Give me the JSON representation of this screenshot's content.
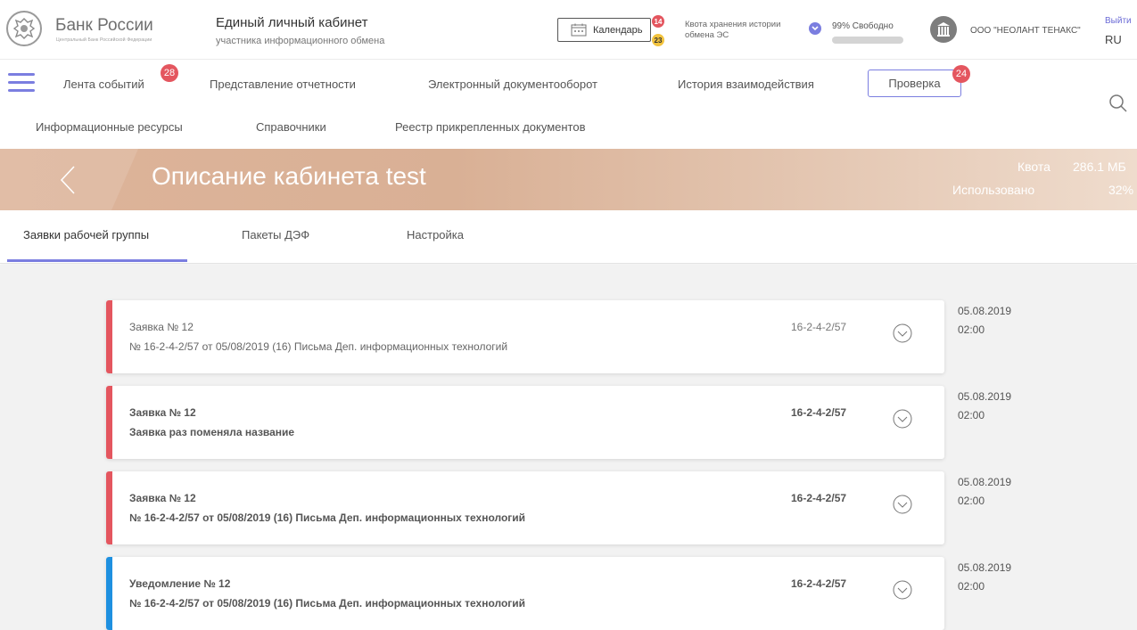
{
  "header": {
    "logo_title": "Банк России",
    "logo_sub": "Центральный Банк Российской Федерации",
    "app_title": "Единый личный кабинет",
    "app_subtitle": "участника информационного обмена",
    "calendar_label": "Календарь",
    "calendar_badge_red": "14",
    "calendar_badge_yellow": "23",
    "quota_label": "Квота хранения истории обмена ЭС",
    "quota_free": "99% Свободно",
    "quota_free_fraction": 0.99,
    "org_name": "ООО \"НЕОЛАНТ ТЕНАКС\"",
    "logout_label": "Выйти",
    "language": "RU"
  },
  "nav": {
    "events": "Лента событий",
    "events_badge": "28",
    "reporting": "Представление отчетности",
    "edo": "Электронный документооборот",
    "history": "История взаимодействия",
    "check": "Проверка",
    "check_badge": "24",
    "resources": "Информационные ресурсы",
    "directories": "Справочники",
    "registry": "Реестр прикрепленных документов"
  },
  "banner": {
    "title": "Описание кабинета test",
    "quota_label": "Квота",
    "quota_value": "286.1 МБ",
    "used_label": "Использовано",
    "used_value": "32%"
  },
  "tabs": [
    {
      "label": "Заявки рабочей группы",
      "active": true
    },
    {
      "label": "Пакеты ДЭФ",
      "active": false
    },
    {
      "label": "Настройка",
      "active": false
    }
  ],
  "colors": {
    "accent": "#7b7ee0",
    "badge_red": "#e4565f",
    "strip_red": "#e4565f",
    "strip_blue": "#1e90e0"
  },
  "cards": [
    {
      "title": "Заявка  № 12",
      "desc": "№ 16-2-4-2/57 от 05/08/2019 (16) Письма Деп. информационных технологий",
      "number": "16-2-4-2/57",
      "date": "05.08.2019",
      "time": "02:00",
      "strip": "red",
      "bold": false
    },
    {
      "title": "Заявка  № 12",
      "desc": "Заявка раз поменяла название",
      "number": "16-2-4-2/57",
      "date": "05.08.2019",
      "time": "02:00",
      "strip": "red",
      "bold": true
    },
    {
      "title": "Заявка  № 12",
      "desc": "№ 16-2-4-2/57 от 05/08/2019 (16) Письма Деп. информационных технологий",
      "number": "16-2-4-2/57",
      "date": "05.08.2019",
      "time": "02:00",
      "strip": "red",
      "bold": true
    },
    {
      "title": "Уведомление  № 12",
      "desc": "№ 16-2-4-2/57 от 05/08/2019 (16) Письма Деп. информационных технологий",
      "number": "16-2-4-2/57",
      "date": "05.08.2019",
      "time": "02:00",
      "strip": "blue",
      "bold": true
    }
  ]
}
